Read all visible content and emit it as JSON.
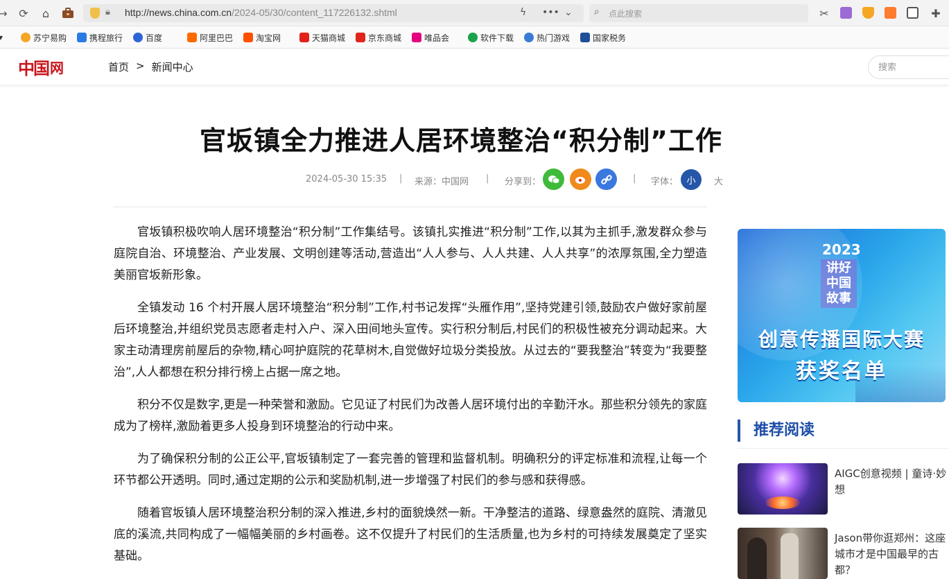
{
  "browser": {
    "url_host": "http://news.china.com.cn",
    "url_path": "/2024-05/30/content_117226132.shtml",
    "search_placeholder": "点此搜索"
  },
  "bookmarks": [
    {
      "label": "苏宁易购",
      "color": "#f5a623"
    },
    {
      "label": "携程旅行",
      "color": "#2b7be4"
    },
    {
      "label": "百度",
      "color": "#2d64d8"
    },
    {
      "label": "阿里巴巴",
      "color": "#ff6a00"
    },
    {
      "label": "淘宝网",
      "color": "#ff5000"
    },
    {
      "label": "天猫商城",
      "color": "#e2231a"
    },
    {
      "label": "京东商城",
      "color": "#e1251b"
    },
    {
      "label": "唯品会",
      "color": "#e4007f"
    },
    {
      "label": "软件下载",
      "color": "#1aa34a"
    },
    {
      "label": "热门游戏",
      "color": "#3a7bd5"
    },
    {
      "label": "国家税务",
      "color": "#1f4e9a"
    }
  ],
  "site": {
    "logo_mark": "中国",
    "logo_net": "网",
    "breadcrumb_home": "首页",
    "breadcrumb_sep": ">",
    "breadcrumb_section": "新闻中心",
    "search_placeholder": "搜索"
  },
  "article": {
    "title": "官坂镇全力推进人居环境整治“积分制”工作",
    "date": "2024-05-30 15:35",
    "source": "来源：中国网",
    "share_label": "分享到：",
    "font_label": "字体：",
    "font_small": "小",
    "font_large": "大",
    "paragraphs": [
      "官坂镇积极吹响人居环境整治“积分制”工作集结号。该镇扎实推进“积分制”工作,以其为主抓手,激发群众参与庭院自治、环境整治、产业发展、文明创建等活动,营造出“人人参与、人人共建、人人共享”的浓厚氛围,全力塑造美丽官坂新形象。",
      "全镇发动 16 个村开展人居环境整治“积分制”工作,村书记发挥“头雁作用”,坚持党建引领,鼓励农户做好家前屋后环境整治,并组织党员志愿者走村入户、深入田间地头宣传。实行积分制后,村民们的积极性被充分调动起来。大家主动清理房前屋后的杂物,精心呵护庭院的花草树木,自觉做好垃圾分类投放。从过去的“要我整治”转变为“我要整治”,人人都想在积分排行榜上占据一席之地。",
      "积分不仅是数字,更是一种荣誉和激励。它见证了村民们为改善人居环境付出的辛勤汗水。那些积分领先的家庭成为了榜样,激励着更多人投身到环境整治的行动中来。",
      "为了确保积分制的公正公平,官坂镇制定了一套完善的管理和监督机制。明确积分的评定标准和流程,让每一个环节都公开透明。同时,通过定期的公示和奖励机制,进一步增强了村民们的参与感和获得感。",
      "随着官坂镇人居环境整治积分制的深入推进,乡村的面貌焕然一新。干净整洁的道路、绿意盎然的庭院、清澈见底的溪流,共同构成了一幅幅美丽的乡村画卷。这不仅提升了村民们的生活质量,也为乡村的可持续发展奠定了坚实基础。"
    ]
  },
  "sidebar": {
    "banner": {
      "year": "2023",
      "story": "讲好中国故事",
      "line1": "创意传播国际大赛",
      "line2": "获奖名单"
    },
    "recommend_title": "推荐阅读",
    "items": [
      {
        "text": "AIGC创意视频 | 童诗·妙想"
      },
      {
        "text": "Jason带你逛郑州：这座城市才是中国最早的古都？"
      }
    ]
  }
}
